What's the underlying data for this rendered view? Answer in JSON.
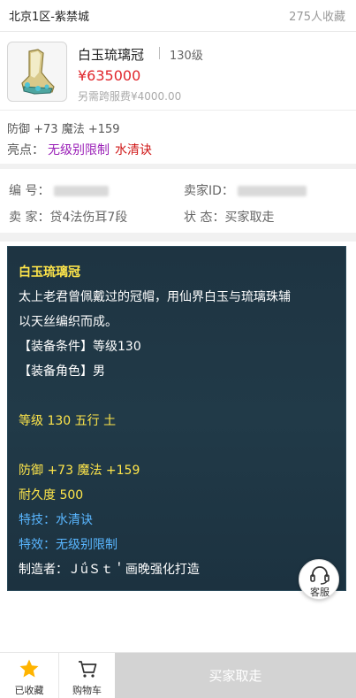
{
  "header": {
    "server": "北京1区-紫禁城",
    "favorites_count": "275人收藏"
  },
  "item": {
    "name": "白玉琉璃冠",
    "level": "130级",
    "price": "¥635000",
    "extra_fee": "另需跨服费¥4000.00",
    "stats": "防御 +73 魔法 +159",
    "highlights_label": "亮点：",
    "highlights": [
      "无级别限制",
      "水清诀"
    ]
  },
  "info": {
    "id_label": "编   号：",
    "seller_id_label": "卖家ID：",
    "seller_label": "卖   家：",
    "seller_value": "贷4法伤耳7段",
    "status_label": "状   态：",
    "status_value": "买家取走"
  },
  "description": {
    "title": "白玉琉璃冠",
    "text_line1": "太上老君曾佩戴过的冠帽，用仙界白玉与琉璃珠辅",
    "text_line2": "以天丝编织而成。",
    "equip_condition": "【装备条件】等级130",
    "equip_role": "【装备角色】男",
    "level_element": "等级 130  五行 土",
    "stats": "防御 +73 魔法 +159",
    "durability": "耐久度 500",
    "skill": "特技：水清诀",
    "effect": "特效：无级别限制",
    "maker": "制造者：ＪǘＳｔ＇画晚强化打造"
  },
  "customer_service": {
    "label": "客服",
    "icon": "headset-icon"
  },
  "bottom_bar": {
    "favorited_label": "已收藏",
    "cart_label": "购物车",
    "buy_label": "买家取走"
  },
  "colors": {
    "price": "#e0262c",
    "highlight_purple": "#9a1fb7",
    "highlight_red": "#d01818",
    "desc_yellow": "#ffe64a",
    "desc_blue": "#59b6ff",
    "star": "#ffb400"
  }
}
